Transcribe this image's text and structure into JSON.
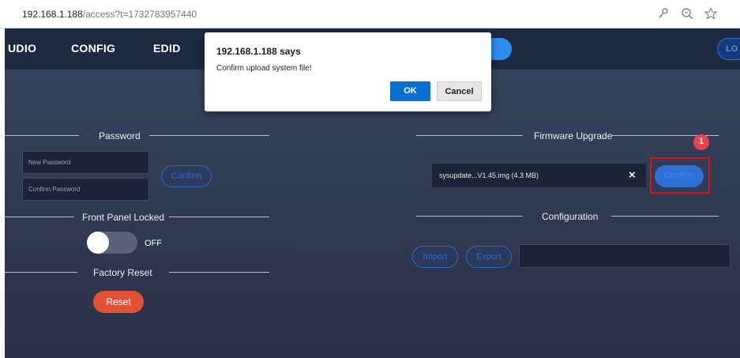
{
  "browser": {
    "url_host": "192.168.1.188",
    "url_path": "/access?t=1732783957440"
  },
  "nav": {
    "items": [
      "UDIO",
      "CONFIG",
      "EDID"
    ],
    "logout_label": "LO"
  },
  "left": {
    "password": {
      "title": "Password",
      "new_placeholder": "New Password",
      "confirm_placeholder": "Confirm Password",
      "confirm_button": "Confirm"
    },
    "front_panel": {
      "title": "Front Panel Locked",
      "state": "OFF"
    },
    "factory_reset": {
      "title": "Factory Reset",
      "button": "Reset"
    }
  },
  "right": {
    "firmware": {
      "title": "Firmware Upgrade",
      "file_name": "sysupdate...V1.45.img (4.3 MB)",
      "clear_symbol": "×",
      "confirm_button": "Confirm",
      "step_number": "1"
    },
    "configuration": {
      "title": "Configuration",
      "import_button": "Import",
      "export_button": "Export"
    }
  },
  "dialog": {
    "title": "192.168.1.188  says",
    "message": "Confirm upload system file!",
    "ok": "OK",
    "cancel": "Cancel"
  },
  "icons": [
    "key-icon",
    "zoom-icon",
    "star-icon"
  ],
  "colors": {
    "accent": "#2e6fd8",
    "reset": "#e45236",
    "highlight": "#d6141c",
    "background": "#323c55"
  }
}
